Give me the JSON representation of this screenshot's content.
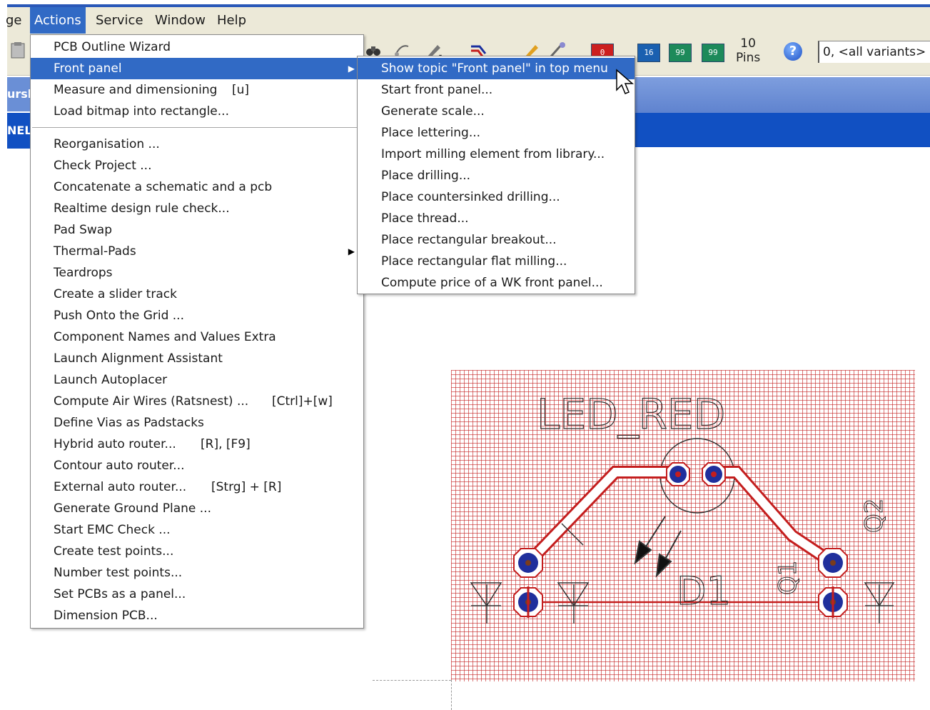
{
  "menubar": {
    "items": [
      {
        "label": "ge"
      },
      {
        "label": "Actions"
      },
      {
        "label": "Service"
      },
      {
        "label": "Window"
      },
      {
        "label": "Help"
      }
    ]
  },
  "toolbar": {
    "chip_red": "0",
    "chip_16": "16",
    "chip_99a": "99",
    "chip_99b": "99",
    "pins_count": "10",
    "pins_label": "Pins",
    "help_glyph": "?",
    "variant_value": "0, <all variants>"
  },
  "left_partial": {
    "strip1": "ursl",
    "strip2": "NEL"
  },
  "actions_menu": {
    "items": [
      {
        "label": "PCB Outline Wizard"
      },
      {
        "label": "Front panel",
        "submenu": true
      },
      {
        "label": "Measure and dimensioning",
        "shortcut": "[u]"
      },
      {
        "label": "Load bitmap into rectangle..."
      },
      {
        "label": "Reorganisation ..."
      },
      {
        "label": "Check Project ..."
      },
      {
        "label": "Concatenate a schematic and a pcb"
      },
      {
        "label": "Realtime design rule check..."
      },
      {
        "label": "Pad Swap"
      },
      {
        "label": "Thermal-Pads",
        "submenu": true
      },
      {
        "label": "Teardrops"
      },
      {
        "label": "Create a slider track"
      },
      {
        "label": "Push Onto the Grid ..."
      },
      {
        "label": "Component Names and Values Extra"
      },
      {
        "label": "Launch Alignment Assistant"
      },
      {
        "label": "Launch Autoplacer"
      },
      {
        "label": "Compute Air Wires (Ratsnest) ...",
        "shortcut": "[Ctrl]+[w]"
      },
      {
        "label": "Define Vias as Padstacks"
      },
      {
        "label": "Hybrid auto router...",
        "shortcut": "[R], [F9]"
      },
      {
        "label": "Contour auto router..."
      },
      {
        "label": "External auto router...",
        "shortcut": "[Strg] + [R]"
      },
      {
        "label": "Generate Ground Plane ..."
      },
      {
        "label": "Start EMC Check ..."
      },
      {
        "label": "Create test points..."
      },
      {
        "label": "Number test points..."
      },
      {
        "label": "Set PCBs as a panel..."
      },
      {
        "label": "Dimension PCB..."
      }
    ]
  },
  "front_panel_submenu": {
    "items": [
      {
        "label": "Show topic \"Front panel\" in top menu"
      },
      {
        "label": "Start front panel..."
      },
      {
        "label": "Generate scale..."
      },
      {
        "label": "Place lettering..."
      },
      {
        "label": "Import milling element from library..."
      },
      {
        "label": "Place drilling..."
      },
      {
        "label": "Place countersinked drilling..."
      },
      {
        "label": "Place thread..."
      },
      {
        "label": "Place rectangular breakout..."
      },
      {
        "label": "Place rectangular flat milling..."
      },
      {
        "label": "Compute price of a WK front panel..."
      }
    ]
  },
  "pcb": {
    "component_value": "LED_RED",
    "component_name": "D1",
    "label_q1": "Q1",
    "label_q2": "Q2",
    "colors": {
      "grid": "#c62828",
      "pad": "#1f2f9c",
      "track": "#c41e1e"
    }
  }
}
